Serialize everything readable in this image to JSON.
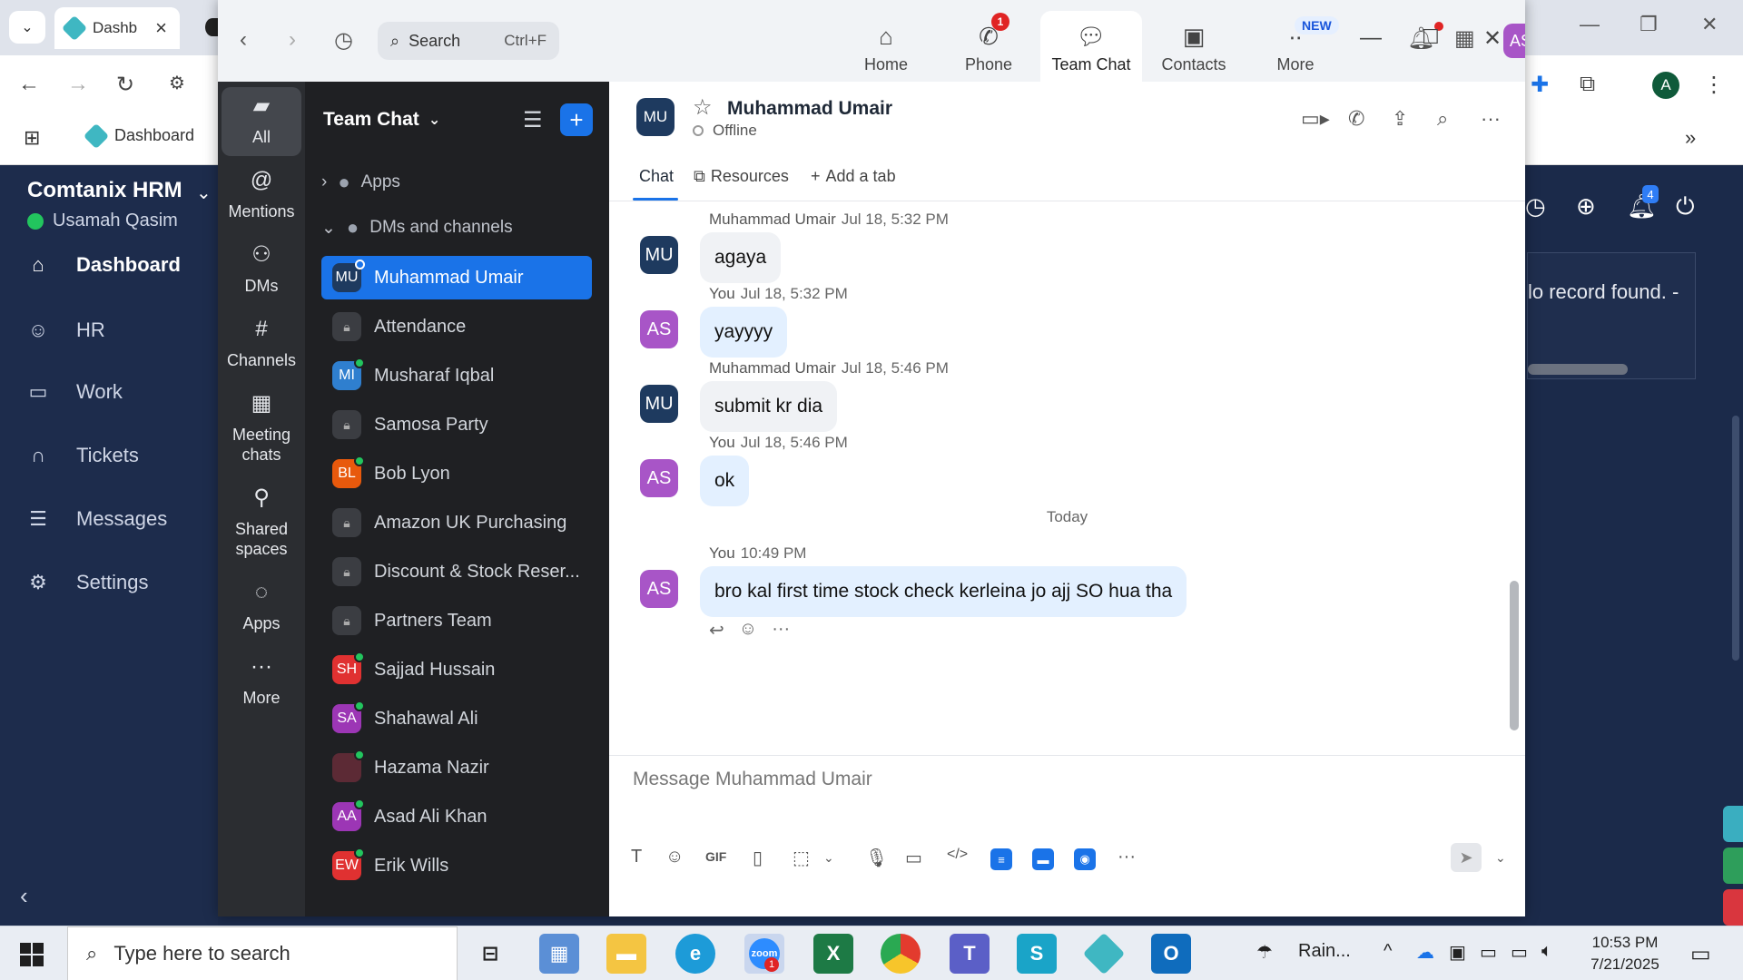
{
  "browser": {
    "tab_title": "Dashb",
    "bookmark": "Dashboard",
    "profile_initial": "A"
  },
  "hrm": {
    "brand": "Comtanix HRM",
    "user": "Usamah Qasim",
    "nav": [
      "Dashboard",
      "HR",
      "Work",
      "Tickets",
      "Messages",
      "Settings"
    ],
    "notification_count": "4",
    "card_text": "lo record found. -"
  },
  "zoom": {
    "search_placeholder": "Search",
    "search_shortcut": "Ctrl+F",
    "nav_tabs": [
      "Home",
      "Phone",
      "Team Chat",
      "Contacts",
      "More"
    ],
    "phone_badge": "1",
    "new_badge": "NEW",
    "avatar_initials": "AS",
    "rail": [
      "All",
      "Mentions",
      "DMs",
      "Channels",
      "Meeting chats",
      "Shared spaces",
      "Apps",
      "More"
    ],
    "list_title": "Team Chat",
    "sections": {
      "apps": "Apps",
      "dms": "DMs and channels"
    },
    "channels": [
      {
        "name": "Muhammad Umair",
        "initials": "MU",
        "color": "#1e3a5f",
        "type": "dm",
        "active": true
      },
      {
        "name": "Attendance",
        "initials": "",
        "type": "lock"
      },
      {
        "name": "Musharaf Iqbal",
        "initials": "MI",
        "color": "#2f7fcf",
        "type": "dm",
        "online": true
      },
      {
        "name": "Samosa Party",
        "initials": "",
        "type": "lock"
      },
      {
        "name": "Bob Lyon",
        "initials": "BL",
        "color": "#e8590c",
        "type": "dm",
        "online": true
      },
      {
        "name": "Amazon UK Purchasing",
        "initials": "",
        "type": "lock"
      },
      {
        "name": "Discount & Stock Reser...",
        "initials": "",
        "type": "lock"
      },
      {
        "name": "Partners Team",
        "initials": "",
        "type": "lock"
      },
      {
        "name": "Sajjad Hussain",
        "initials": "SH",
        "color": "#e03131",
        "type": "dm",
        "online": true
      },
      {
        "name": "Shahawal Ali",
        "initials": "SA",
        "color": "#9c36b5",
        "type": "dm",
        "online": true
      },
      {
        "name": "Hazama Nazir",
        "initials": "",
        "color": "#5c2a35",
        "type": "dm",
        "online": true
      },
      {
        "name": "Asad Ali Khan",
        "initials": "AA",
        "color": "#9c36b5",
        "type": "dm",
        "online": true
      },
      {
        "name": "Erik Wills",
        "initials": "EW",
        "color": "#e03131",
        "type": "dm",
        "online": true
      }
    ],
    "chat": {
      "name": "Muhammad Umair",
      "initials": "MU",
      "status": "Offline",
      "tabs": [
        "Chat",
        "Resources",
        "Add a tab"
      ],
      "today_label": "Today",
      "messages": [
        {
          "sender": "Muhammad Umair",
          "time": "Jul 18, 5:32 PM",
          "text": "agaya",
          "initials": "MU",
          "mine": false
        },
        {
          "sender": "You",
          "time": "Jul 18, 5:32 PM",
          "text": "yayyyy",
          "initials": "AS",
          "mine": true
        },
        {
          "sender": "Muhammad Umair",
          "time": "Jul 18, 5:46 PM",
          "text": "submit kr dia",
          "initials": "MU",
          "mine": false
        },
        {
          "sender": "You",
          "time": "Jul 18, 5:46 PM",
          "text": "ok",
          "initials": "AS",
          "mine": true
        },
        {
          "sender": "You",
          "time": "10:49 PM",
          "text": "bro kal first time stock check kerleina jo ajj SO hua tha",
          "initials": "AS",
          "mine": true
        }
      ],
      "compose_placeholder": "Message Muhammad Umair"
    }
  },
  "taskbar": {
    "search_placeholder": "Type here to search",
    "weather": "Rain...",
    "time": "10:53 PM",
    "date": "7/21/2025",
    "zoom_badge": "1"
  },
  "colors": {
    "accent": "#1a73e8",
    "rail_bg": "#2b2d31",
    "list_bg": "#1f2023",
    "hrm_bg": "#1b2a4a",
    "online": "#22c55e"
  }
}
